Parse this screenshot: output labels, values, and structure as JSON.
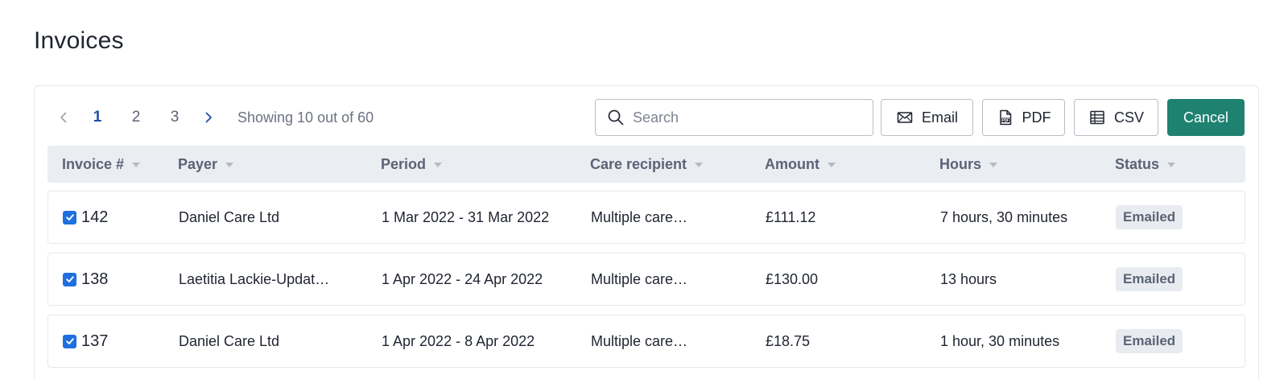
{
  "page": {
    "title": "Invoices"
  },
  "pagination": {
    "pages": [
      "1",
      "2",
      "3"
    ],
    "active_page": "1",
    "showing_text": "Showing 10 out of 60"
  },
  "search": {
    "placeholder": "Search",
    "value": ""
  },
  "toolbar": {
    "email_label": "Email",
    "pdf_label": "PDF",
    "csv_label": "CSV",
    "cancel_label": "Cancel"
  },
  "table": {
    "columns": [
      "Invoice #",
      "Payer",
      "Period",
      "Care recipient",
      "Amount",
      "Hours",
      "Status"
    ],
    "rows": [
      {
        "invoice": "142",
        "payer": "Daniel Care Ltd",
        "period": "1 Mar 2022 - 31 Mar 2022",
        "care_recipient": "Multiple care…",
        "amount": "£111.12",
        "hours": "7 hours, 30 minutes",
        "status": "Emailed",
        "checked": true
      },
      {
        "invoice": "138",
        "payer": "Laetitia Lackie-Updat…",
        "period": "1 Apr 2022 - 24 Apr 2022",
        "care_recipient": "Multiple care…",
        "amount": "£130.00",
        "hours": "13 hours",
        "status": "Emailed",
        "checked": true
      },
      {
        "invoice": "137",
        "payer": "Daniel Care Ltd",
        "period": "1 Apr 2022 - 8 Apr 2022",
        "care_recipient": "Multiple care…",
        "amount": "£18.75",
        "hours": "1 hour, 30 minutes",
        "status": "Emailed",
        "checked": true
      }
    ]
  },
  "colors": {
    "accent": "#1f8271",
    "active_page": "#1f4fa0",
    "checkbox": "#1e6fe0",
    "header_bg": "#eaedf2",
    "badge_bg": "#e8ebf0"
  },
  "icons": {
    "prev": "chevron-left-icon",
    "next": "chevron-right-icon",
    "search": "search-icon",
    "email": "envelope-icon",
    "pdf": "pdf-file-icon",
    "csv": "table-icon",
    "sort": "caret-down-icon",
    "checkbox": "checkmark-icon"
  }
}
